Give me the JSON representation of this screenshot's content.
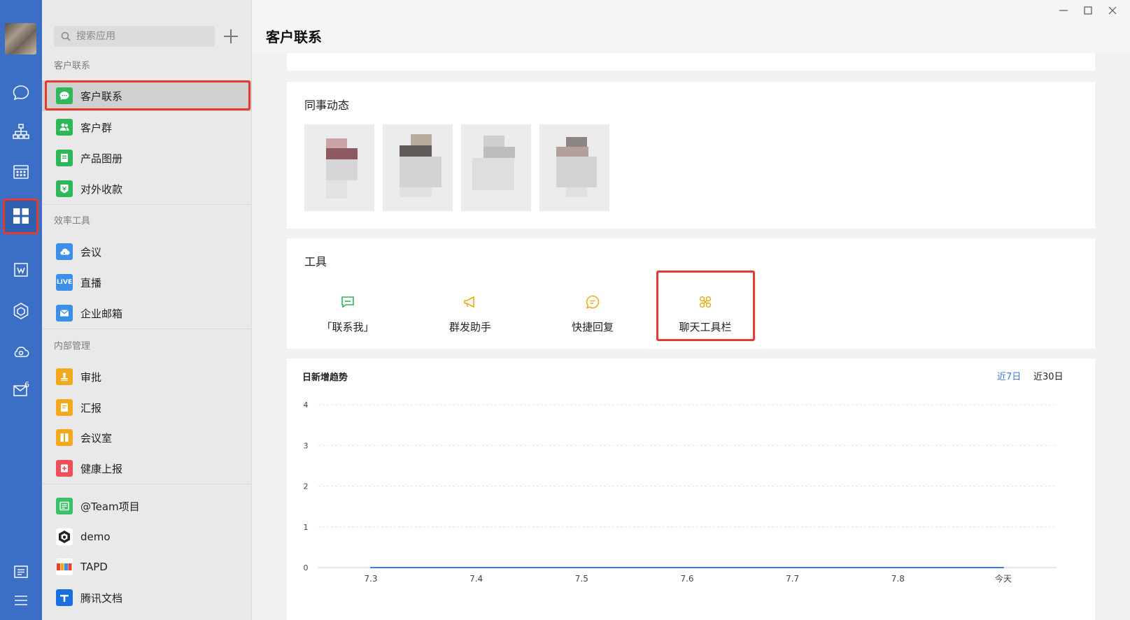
{
  "rail": {
    "mail_badge": "6"
  },
  "panel": {
    "search_placeholder": "搜索应用",
    "sections": {
      "customer": "客户联系",
      "efficiency": "效率工具",
      "internal": "内部管理"
    },
    "items": [
      {
        "label": "客户联系",
        "icon": "chat-bubble-icon",
        "color": "#2fb85a"
      },
      {
        "label": "客户群",
        "icon": "customer-group-icon",
        "color": "#2fb85a"
      },
      {
        "label": "产品图册",
        "icon": "product-album-icon",
        "color": "#2fb85a"
      },
      {
        "label": "对外收款",
        "icon": "payment-icon",
        "color": "#2fb85a"
      },
      {
        "label": "会议",
        "icon": "meeting-cloud-icon",
        "color": "#3d8ee8"
      },
      {
        "label": "直播",
        "icon": "live-icon",
        "icon_text": "LIVE",
        "color": "#3d8ee8"
      },
      {
        "label": "企业邮箱",
        "icon": "mail-icon",
        "color": "#3d8ee8"
      },
      {
        "label": "审批",
        "icon": "approval-stamp-icon",
        "color": "#f3a91c"
      },
      {
        "label": "汇报",
        "icon": "report-icon",
        "color": "#f3a91c"
      },
      {
        "label": "会议室",
        "icon": "meeting-room-icon",
        "color": "#f3a91c"
      },
      {
        "label": "健康上报",
        "icon": "health-report-icon",
        "color": "#ee4d5a"
      },
      {
        "label": "@Team项目",
        "icon": "team-project-icon",
        "color": "#3bbf6a"
      },
      {
        "label": "demo",
        "icon": "demo-logo-icon",
        "color": "#222222"
      },
      {
        "label": "TAPD",
        "icon": "tapd-logo-icon",
        "color": "#ffffff"
      },
      {
        "label": "腾讯文档",
        "icon": "tencent-docs-icon",
        "color": "#1a6fe0"
      }
    ]
  },
  "main": {
    "title": "客户联系",
    "colleagues_title": "同事动态",
    "tools_title": "工具",
    "tools": [
      {
        "label": "「联系我」",
        "icon": "contact-me-icon",
        "color": "#2fb85a"
      },
      {
        "label": "群发助手",
        "icon": "broadcast-icon",
        "color": "#f3a91c"
      },
      {
        "label": "快捷回复",
        "icon": "quick-reply-icon",
        "color": "#f3a91c"
      },
      {
        "label": "聊天工具栏",
        "icon": "chat-toolbar-icon",
        "color": "#f3a91c"
      }
    ]
  },
  "chart_data": {
    "type": "line",
    "title": "日新增趋势",
    "range_options": [
      "近7日",
      "近30日"
    ],
    "selected_range": "近7日",
    "categories": [
      "7.3",
      "7.4",
      "7.5",
      "7.6",
      "7.7",
      "7.8",
      "今天"
    ],
    "series": [
      {
        "values": [
          0,
          0,
          0,
          0,
          0,
          0,
          0
        ],
        "color": "#3a7be0"
      }
    ],
    "y_ticks": [
      0,
      1,
      2,
      3,
      4
    ],
    "ylim": [
      0,
      4
    ],
    "grid": true
  }
}
